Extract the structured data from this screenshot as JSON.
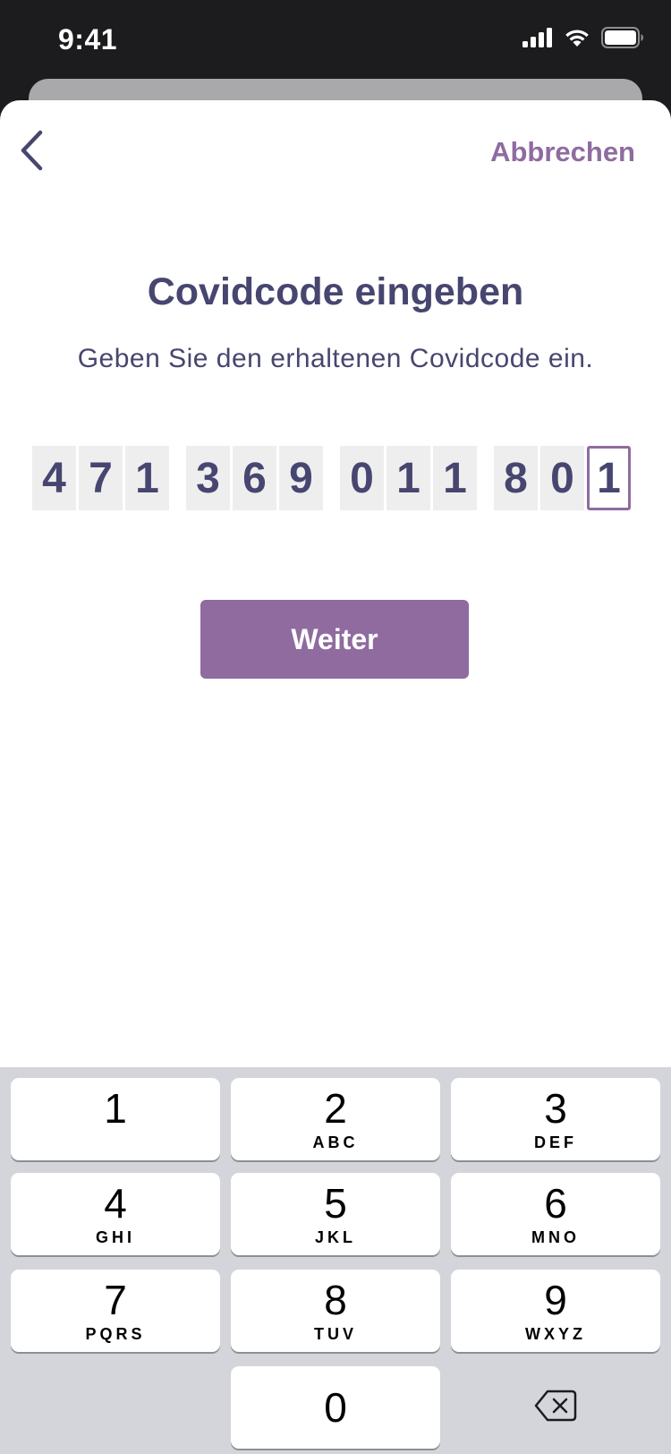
{
  "status_bar": {
    "time": "9:41"
  },
  "header": {
    "cancel_label": "Abbrechen"
  },
  "content": {
    "title": "Covidcode eingeben",
    "subtitle": "Geben Sie den erhaltenen Covidcode ein.",
    "code_groups": [
      [
        "4",
        "7",
        "1"
      ],
      [
        "3",
        "6",
        "9"
      ],
      [
        "0",
        "1",
        "1"
      ],
      [
        "8",
        "0",
        "1"
      ]
    ],
    "primary_button": "Weiter"
  },
  "keyboard": {
    "keys": [
      {
        "digit": "1",
        "letters": ""
      },
      {
        "digit": "2",
        "letters": "ABC"
      },
      {
        "digit": "3",
        "letters": "DEF"
      },
      {
        "digit": "4",
        "letters": "GHI"
      },
      {
        "digit": "5",
        "letters": "JKL"
      },
      {
        "digit": "6",
        "letters": "MNO"
      },
      {
        "digit": "7",
        "letters": "PQRS"
      },
      {
        "digit": "8",
        "letters": "TUV"
      },
      {
        "digit": "9",
        "letters": "WXYZ"
      },
      {
        "digit": "0",
        "letters": ""
      }
    ]
  },
  "colors": {
    "accent": "#8f6ba0",
    "text_primary": "#474670",
    "keyboard_bg": "#d3d5da"
  }
}
